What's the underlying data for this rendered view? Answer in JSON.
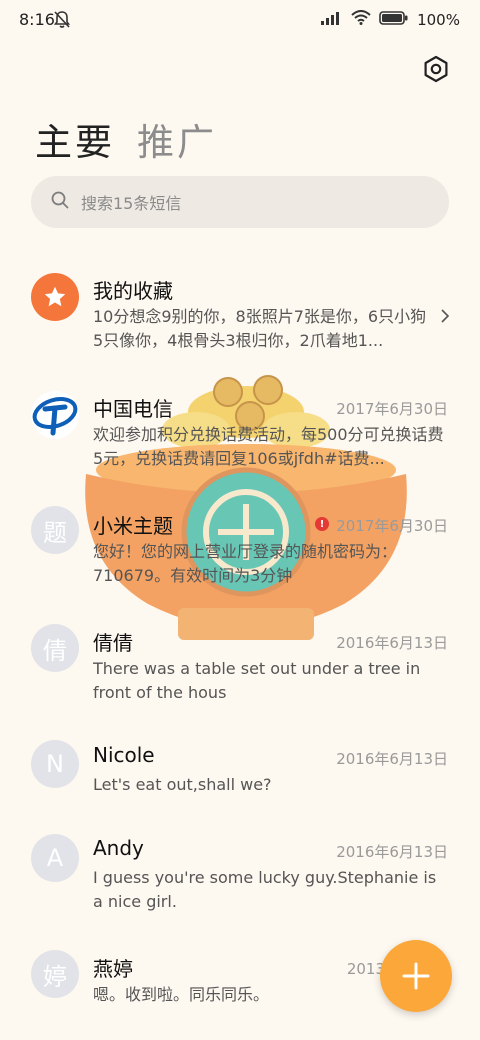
{
  "status_bar": {
    "time": "8:16",
    "battery": "100"
  },
  "tabs": [
    {
      "label": "主要"
    },
    {
      "label": "推广"
    }
  ],
  "search": {
    "placeholder": "搜索15条短信"
  },
  "messages": [
    {
      "name": "我的收藏",
      "date": "",
      "preview": "10分想念9别的你，8张照片7张是你，6只小狗5只像你，4根骨头3根归你，2爪着地1...",
      "avatar": "star-icon"
    },
    {
      "name": "中国电信",
      "date": "2017年6月30日",
      "preview": "欢迎参加积分兑换话费活动，每500分可兑换话费5元，兑换话费请回复106或jfdh#话费...",
      "avatar": "china-telecom-logo"
    },
    {
      "name": "小米主题",
      "date": "2017年6月30日",
      "preview": "您好！您的网上营业厅登录的随机密码为：710679。有效时间为3分钟",
      "avatar_text": "题"
    },
    {
      "name": "倩倩",
      "date": "2016年6月13日",
      "preview": "There was a table set out under a tree in front of the hous",
      "avatar_text": "倩"
    },
    {
      "name": "Nicole",
      "date": "2016年6月13日",
      "preview": "Let's eat out,shall we?",
      "avatar_text": "N"
    },
    {
      "name": "Andy",
      "date": "2016年6月13日",
      "preview": "I guess you're some lucky guy.Stephanie is a nice girl.",
      "avatar_text": "A"
    },
    {
      "name": "燕婷",
      "date": "2013年",
      "preview": "嗯。收到啦。同乐同乐。",
      "avatar_text": "婷"
    }
  ],
  "colors": {
    "accent": "#fba73a",
    "star_avatar": "#f5763a",
    "telecom_blue": "#0d5fb8",
    "alert": "#e53935"
  }
}
